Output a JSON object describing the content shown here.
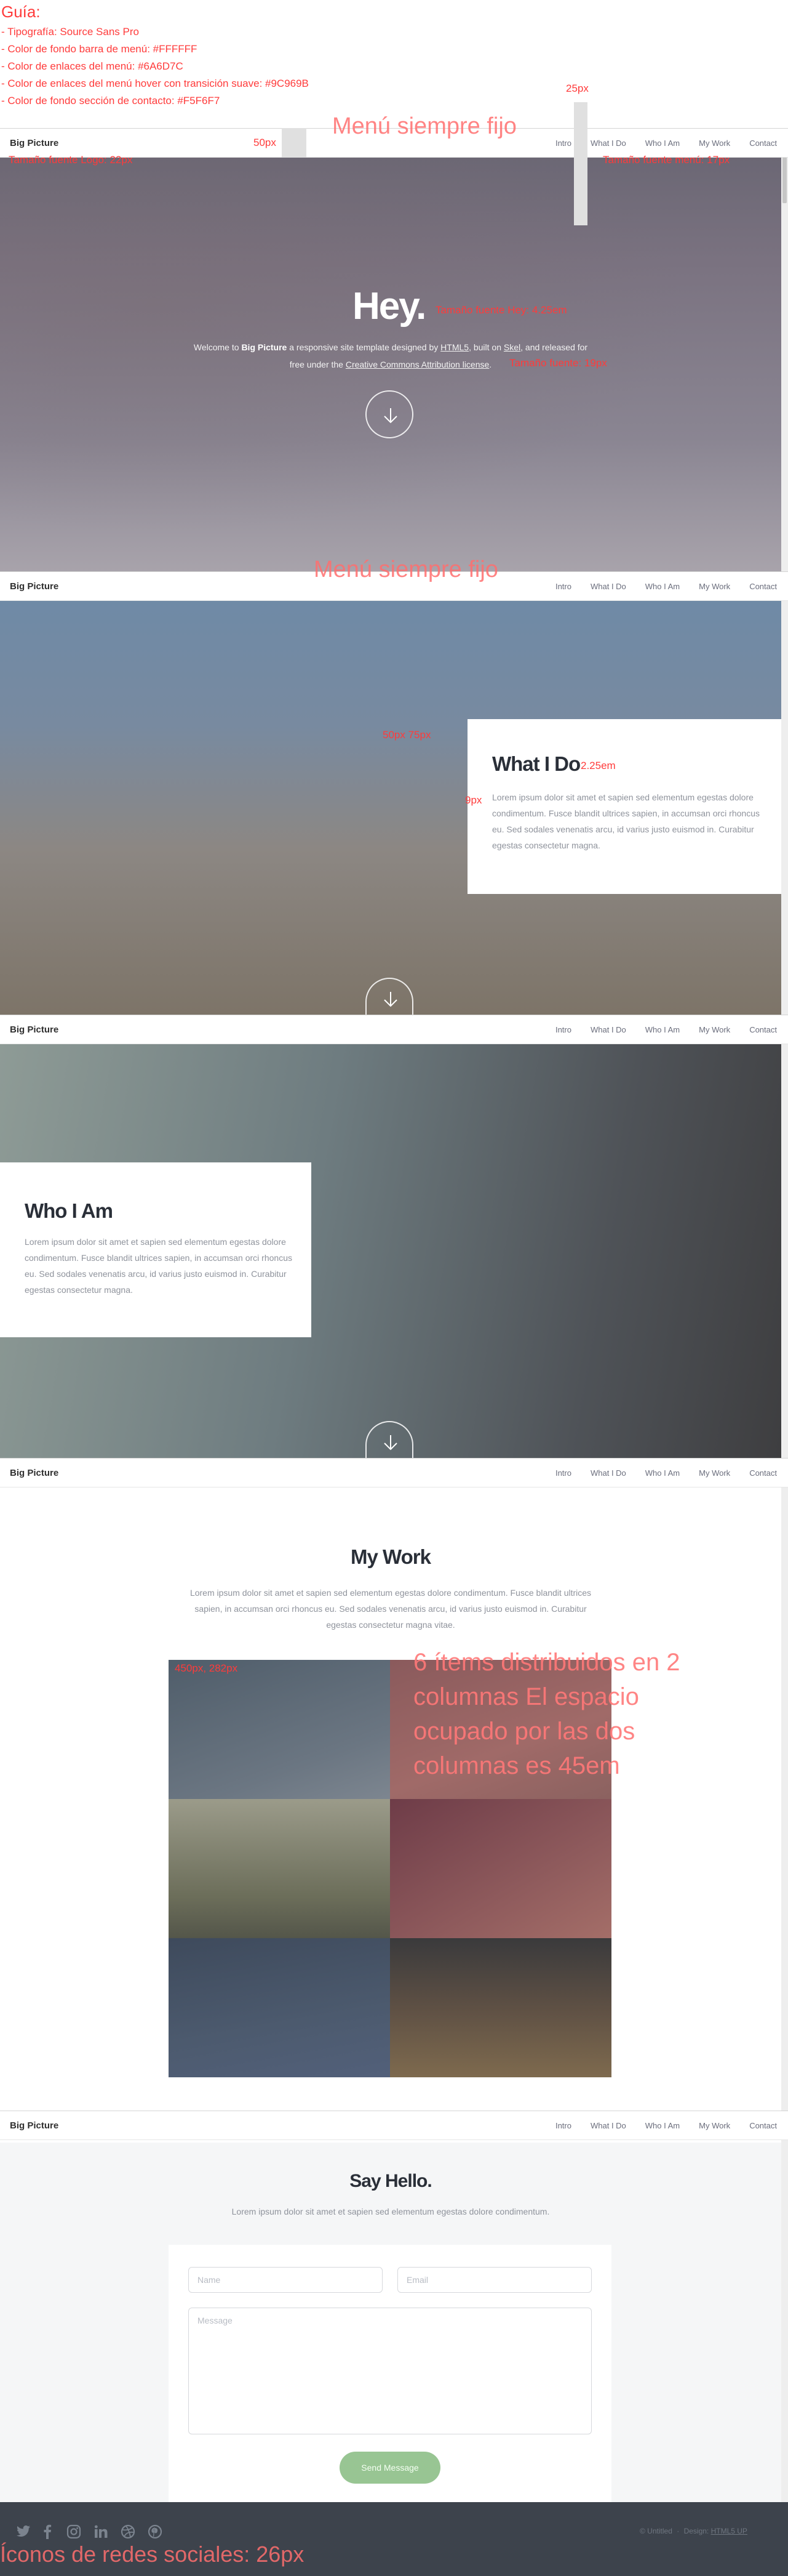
{
  "guide": {
    "heading": "Guía:",
    "lines": [
      "- Tipografía: Source Sans Pro",
      "- Color de fondo barra de menú: #FFFFFF",
      "- Color de enlaces del menú: #6A6D7C",
      "- Color de enlaces del menú hover con transición suave: #9C969B",
      "- Color de fondo sección de contacto: #F5F6F7"
    ],
    "spacing_25": "25px",
    "spacing_50": "50px",
    "menu_fixed": "Menú siempre fijo",
    "logo_size": "Tamaño fuente Logo: 22px",
    "menu_size": "Tamaño fuente menú: 17px",
    "hey_size": "Tamaño fuente Hey: 4.25em",
    "text_size": "Tamaño fuente: 19px",
    "box_padding": "50px 75px",
    "title_size": "2.25em",
    "gap_9": "9px",
    "tile_size": "450px, 282px",
    "grid_note": "6 ítems distribuidos en 2 columnas El espacio ocupado por las dos columnas es 45em",
    "social_size": "Íconos de redes sociales: 26px"
  },
  "nav": {
    "logo": "Big Picture",
    "items": [
      "Intro",
      "What I Do",
      "Who I Am",
      "My Work",
      "Contact"
    ]
  },
  "hero": {
    "title": "Hey.",
    "text_1": "Welcome to",
    "text_brand": "Big Picture",
    "text_2": "a responsive site template designed by",
    "text_link1": "HTML5",
    "text_3": ", built on",
    "text_link2": "Skel",
    "text_4": ", and released for",
    "text_5": "free under the",
    "text_link3": "Creative Commons Attribution license",
    "text_6": "."
  },
  "what": {
    "title": "What I Do",
    "body": "Lorem ipsum dolor sit amet et sapien sed elementum egestas dolore condimentum. Fusce blandit ultrices sapien, in accumsan orci rhoncus eu. Sed sodales venenatis arcu, id varius justo euismod in. Curabitur egestas consectetur magna."
  },
  "who": {
    "title": "Who I Am",
    "body": "Lorem ipsum dolor sit amet et sapien sed elementum egestas dolore condimentum. Fusce blandit ultrices sapien, in accumsan orci rhoncus eu. Sed sodales venenatis arcu, id varius justo euismod in. Curabitur egestas consectetur magna."
  },
  "work": {
    "title": "My Work",
    "body": "Lorem ipsum dolor sit amet et sapien sed elementum egestas dolore condimentum. Fusce blandit ultrices sapien, in accumsan orci rhoncus eu. Sed sodales venenatis arcu, id varius justo euismod in. Curabitur egestas consectetur magna vitae."
  },
  "contact": {
    "title": "Say Hello.",
    "body": "Lorem ipsum dolor sit amet et sapien sed elementum egestas dolore condimentum.",
    "name_placeholder": "Name",
    "email_placeholder": "Email",
    "message_placeholder": "Message",
    "send": "Send Message"
  },
  "footer": {
    "copyright": "© Untitled",
    "design_label": "Design:",
    "design_link": "HTML5 UP",
    "icons": [
      "twitter-icon",
      "facebook-icon",
      "instagram-icon",
      "linkedin-icon",
      "dribbble-icon",
      "pinterest-icon"
    ]
  },
  "colors": {
    "menu_bg": "#FFFFFF",
    "menu_link": "#6A6D7C",
    "menu_hover": "#9C969B",
    "contact_bg": "#F5F6F7",
    "accent_green": "#98c593"
  }
}
